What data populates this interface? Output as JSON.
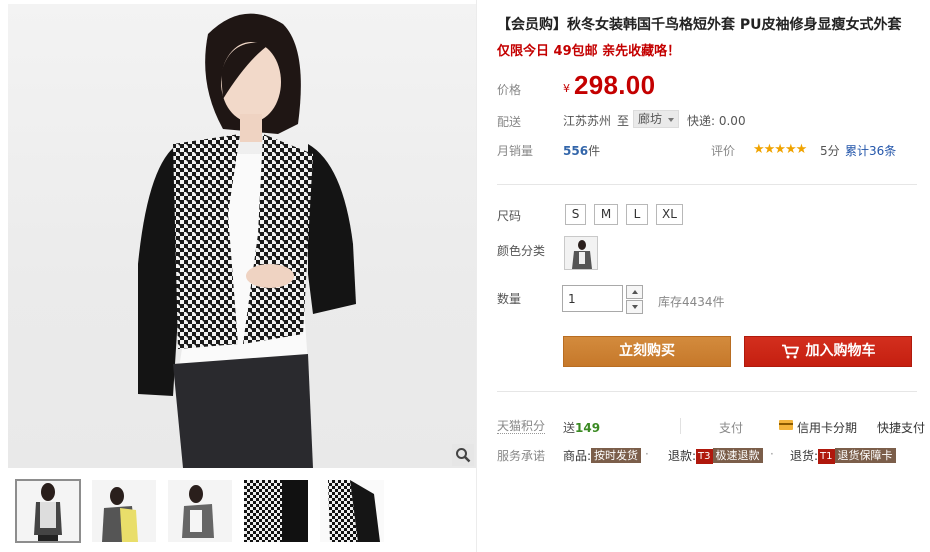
{
  "product": {
    "title": "【会员购】秋冬女装韩国千鸟格短外套 PU皮袖修身显瘦女式外套",
    "subtitle": "仅限今日 49包邮 亲先收藏咯！"
  },
  "price": {
    "label": "价格",
    "currency": "¥",
    "value": "298.00",
    "color": "#c40000"
  },
  "shipping": {
    "label": "配送",
    "from": "江苏苏州",
    "to_label": "至",
    "to_city": "廊坊",
    "express": "快递: 0.00"
  },
  "sales": {
    "label": "月销量",
    "count": "556",
    "unit": "件",
    "rating_label": "评价",
    "stars": "★★★★★",
    "score": "5分",
    "reviews": "累计36条"
  },
  "options": {
    "size_label": "尺码",
    "sizes": [
      "S",
      "M",
      "L",
      "XL"
    ],
    "color_label": "颜色分类",
    "qty_label": "数量",
    "qty_value": "1",
    "stock": "库存4434件"
  },
  "actions": {
    "buy_now": "立刻购买",
    "add_to_cart": "加入购物车"
  },
  "extras": {
    "points_label": "天猫积分",
    "points_prefix": "送",
    "points_value": "149",
    "pay_label": "支付",
    "credit_card": "信用卡分期",
    "quick_pay": "快捷支付"
  },
  "service": {
    "label": "服务承诺",
    "goods_label": "商品:",
    "goods_badge": "按时发货",
    "refund_label": "退款:",
    "refund_tag": "T3",
    "refund_badge": "极速退款",
    "return_label": "退货:",
    "return_tag": "T1",
    "return_badge": "退货保障卡"
  },
  "icons": {
    "zoom": "magnifier-icon",
    "cart": "cart-icon",
    "card": "credit-card-icon"
  }
}
